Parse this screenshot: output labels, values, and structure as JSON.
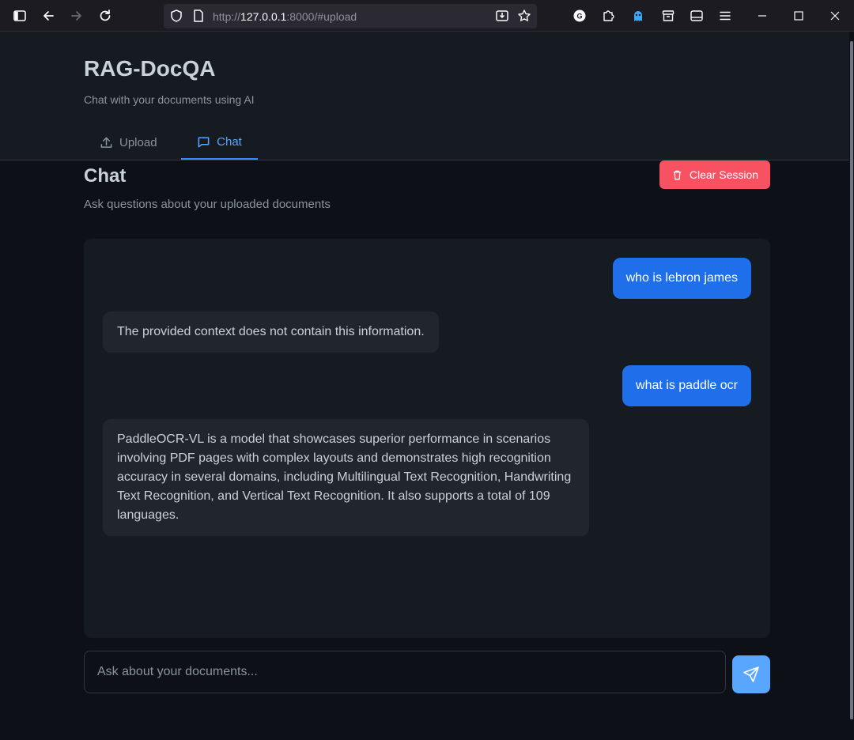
{
  "browser": {
    "url_prefix": "http://",
    "url_host": "127.0.0.1",
    "url_rest": ":8000/#upload"
  },
  "app": {
    "title": "RAG-DocQA",
    "subtitle": "Chat with your documents using AI"
  },
  "tabs": [
    {
      "label": "Upload",
      "icon": "upload-icon",
      "active": false
    },
    {
      "label": "Chat",
      "icon": "message-square-icon",
      "active": true
    }
  ],
  "chat": {
    "title": "Chat",
    "subtitle": "Ask questions about your uploaded documents",
    "clear_label": "Clear Session",
    "messages": [
      {
        "role": "user",
        "text": "who is lebron james"
      },
      {
        "role": "assistant",
        "text": "The provided context does not contain this information."
      },
      {
        "role": "user",
        "text": "what is paddle ocr"
      },
      {
        "role": "assistant",
        "text": "PaddleOCR-VL is a model that showcases superior performance in scenarios involving PDF pages with complex layouts and demonstrates high recognition accuracy in several domains, including Multilingual Text Recognition, Handwriting Text Recognition, and Vertical Text Recognition. It also supports a total of 109 languages."
      }
    ],
    "input_placeholder": "Ask about your documents...",
    "input_value": ""
  },
  "colors": {
    "accent": "#58a6ff",
    "user_bubble": "#1f6feb",
    "danger": "#f85162",
    "background": "#0d1117"
  }
}
